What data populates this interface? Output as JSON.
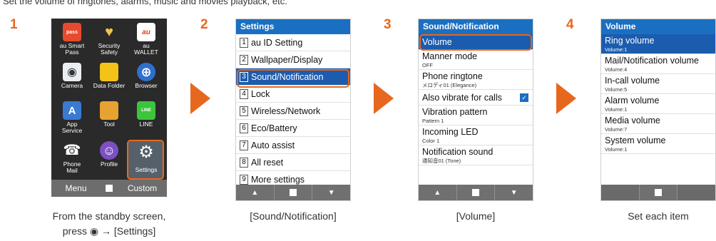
{
  "intro": "Set the volume of ringtones, alarms, music and movies playback, etc.",
  "steps": {
    "s1": {
      "number": "1",
      "caption_line1": "From the standby screen,",
      "caption_line2": "press ◉ → [Settings]"
    },
    "s2": {
      "number": "2",
      "caption": "[Sound/Notification]"
    },
    "s3": {
      "number": "3",
      "caption": "[Volume]"
    },
    "s4": {
      "number": "4",
      "caption": "Set each item"
    }
  },
  "home": {
    "apps": [
      {
        "label": "au Smart\nPass",
        "icon_text": "pass",
        "icon": "pass-icon"
      },
      {
        "label": "Security\nSafety",
        "icon_text": "♥",
        "icon": "heart-icon"
      },
      {
        "label": "au\nWALLET",
        "icon_text": "au",
        "icon": "wallet-icon"
      },
      {
        "label": "Camera",
        "icon_text": "◉",
        "icon": "camera-icon"
      },
      {
        "label": "Data Folder",
        "icon_text": "",
        "icon": "folder-icon"
      },
      {
        "label": "Browser",
        "icon_text": "⊕",
        "icon": "browser-icon"
      },
      {
        "label": "App\nService",
        "icon_text": "A",
        "icon": "app-service-icon"
      },
      {
        "label": "Tool",
        "icon_text": "",
        "icon": "toolbox-icon"
      },
      {
        "label": "LINE",
        "icon_text": "LINE",
        "icon": "line-icon"
      },
      {
        "label": "Phone\nMail",
        "icon_text": "☎",
        "icon": "phone-mail-icon"
      },
      {
        "label": "Profile",
        "icon_text": "☺",
        "icon": "profile-icon"
      },
      {
        "label": "Settings",
        "icon_text": "⚙",
        "icon": "gear-icon"
      }
    ],
    "softkeys": {
      "left": "Menu",
      "right": "Custom"
    }
  },
  "settings_screen": {
    "title": "Settings",
    "items": [
      {
        "n": "1",
        "label": "au ID Setting"
      },
      {
        "n": "2",
        "label": "Wallpaper/Display"
      },
      {
        "n": "3",
        "label": "Sound/Notification"
      },
      {
        "n": "4",
        "label": "Lock"
      },
      {
        "n": "5",
        "label": "Wireless/Network"
      },
      {
        "n": "6",
        "label": "Eco/Battery"
      },
      {
        "n": "7",
        "label": "Auto assist"
      },
      {
        "n": "8",
        "label": "All reset"
      },
      {
        "n": "9",
        "label": "More settings"
      }
    ]
  },
  "sound_screen": {
    "title": "Sound/Notification",
    "items": [
      {
        "label": "Volume",
        "sub": ""
      },
      {
        "label": "Manner mode",
        "sub": "OFF"
      },
      {
        "label": "Phone ringtone",
        "sub": "メロディ01 (Elegance)"
      },
      {
        "label": "Also vibrate for calls",
        "sub": ""
      },
      {
        "label": "Vibration pattern",
        "sub": "Pattern 1"
      },
      {
        "label": "Incoming LED",
        "sub": "Color 1"
      },
      {
        "label": "Notification sound",
        "sub": "通知音01 (Tone)"
      }
    ],
    "checkbox_checked": true
  },
  "volume_screen": {
    "title": "Volume",
    "items": [
      {
        "label": "Ring volume",
        "sub": "Volume:1"
      },
      {
        "label": "Mail/Notification volume",
        "sub": "Volume:4"
      },
      {
        "label": "In-call volume",
        "sub": "Volume:5"
      },
      {
        "label": "Alarm volume",
        "sub": "Volume:1"
      },
      {
        "label": "Media volume",
        "sub": "Volume:7"
      },
      {
        "label": "System volume",
        "sub": "Volume:1"
      }
    ]
  },
  "colors": {
    "accent": "#e8671e",
    "title_bar": "#1b6fc1",
    "selection": "#1b5cae"
  }
}
